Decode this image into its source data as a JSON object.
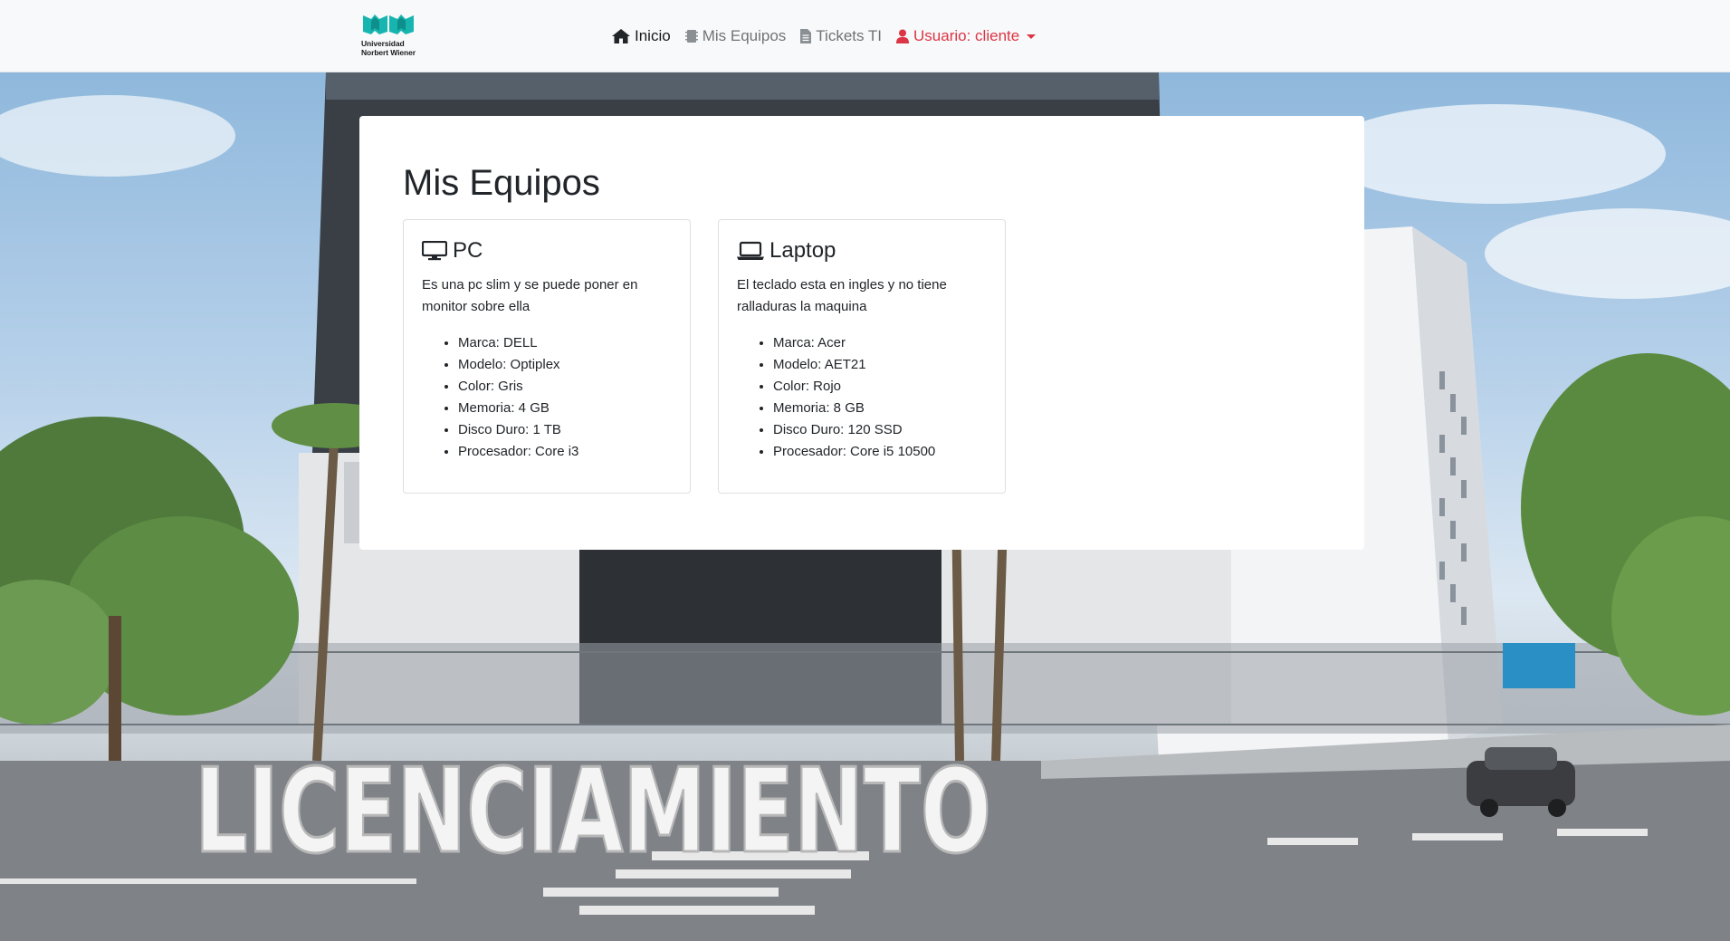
{
  "brand": {
    "logo_line1": "Universidad",
    "logo_line2": "Norbert Wiener",
    "logo_color": "#17b5b0",
    "icon": "open-book-logo"
  },
  "nav": {
    "items": [
      {
        "label": "Inicio",
        "icon": "home-icon",
        "active": true
      },
      {
        "label": "Mis Equipos",
        "icon": "chip-icon",
        "active": false
      },
      {
        "label": "Tickets TI",
        "icon": "document-icon",
        "active": false
      }
    ],
    "user": {
      "label": "Usuario: cliente",
      "icon": "user-icon",
      "color": "#dc3545"
    }
  },
  "main": {
    "title": "Mis Equipos",
    "cards": [
      {
        "title": "PC",
        "icon": "desktop-icon",
        "description": "Es una pc slim y se puede poner en monitor sobre ella",
        "specs": [
          "Marca: DELL",
          "Modelo: Optiplex",
          "Color: Gris",
          "Memoria: 4 GB",
          "Disco Duro: 1 TB",
          "Procesador: Core i3"
        ]
      },
      {
        "title": "Laptop",
        "icon": "laptop-icon",
        "description": "El teclado esta en ingles y no tiene ralladuras la maquina",
        "specs": [
          "Marca: Acer",
          "Modelo: AET21",
          "Color: Rojo",
          "Memoria: 8 GB",
          "Disco Duro: 120 SSD",
          "Procesador: Core i5 10500"
        ]
      }
    ]
  },
  "background": {
    "sign_text": "LICENCIAMIENTO"
  }
}
